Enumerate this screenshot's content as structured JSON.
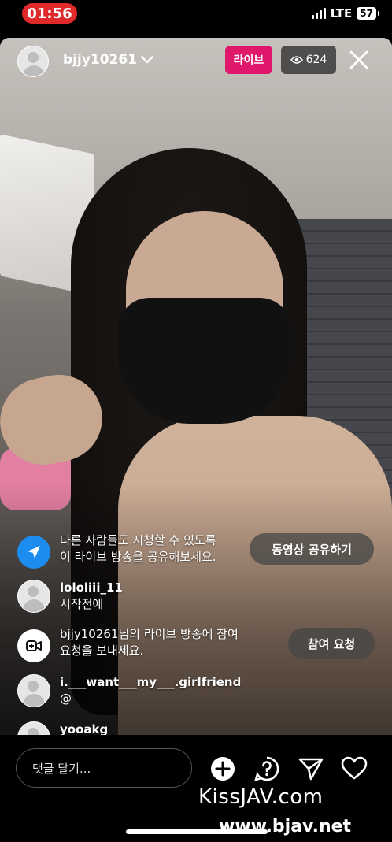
{
  "status_bar": {
    "time": "01:56",
    "network": "LTE",
    "battery": "57"
  },
  "header": {
    "username": "bjjy10261",
    "live_label": "라이브",
    "viewer_count": "624"
  },
  "comments": [
    {
      "type": "system",
      "text_line1": "다른 사람들도 시청할 수 있도록",
      "text_line2": "이 라이브 방송을 공유해보세요.",
      "button": "동영상 공유하기"
    },
    {
      "type": "user",
      "username": "lololiii_11",
      "message": "시작전에"
    },
    {
      "type": "system",
      "text_line1": "bjjy10261님의 라이브 방송에 참여",
      "text_line2": "요청을 보내세요.",
      "button": "참여 요청"
    },
    {
      "type": "user",
      "username": "i.___want___my___.girlfriend",
      "message": "@"
    },
    {
      "type": "user",
      "username": "yooakg",
      "message": ""
    }
  ],
  "bottom_bar": {
    "comment_placeholder": "댓글 달기..."
  },
  "watermarks": {
    "line1": "KissJAV.com",
    "line2": "www.bjav.net"
  },
  "colors": {
    "live_badge": "#e0186c",
    "time_pill": "#e0292b",
    "share_icon_bg": "#1d8cf0"
  }
}
